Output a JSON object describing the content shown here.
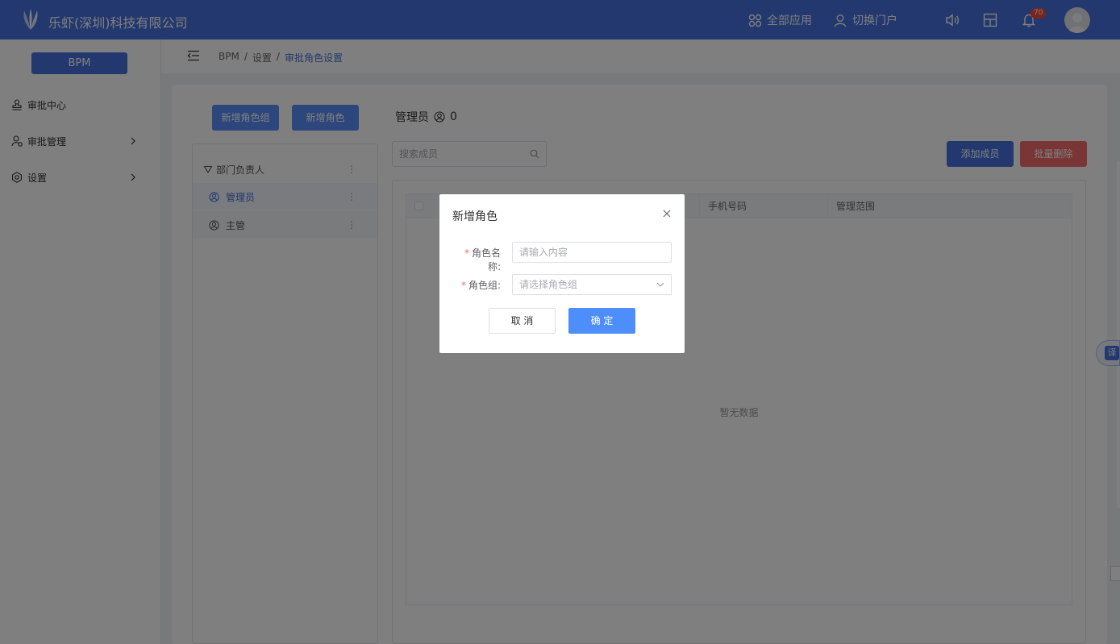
{
  "header": {
    "company": "乐虾(深圳)科技有限公司",
    "nav_all_apps": "全部应用",
    "nav_switch_portal": "切换门户",
    "notification_count": "70",
    "colors": {
      "primary": "#4671dc",
      "badge": "#f5483b"
    }
  },
  "sidebar": {
    "app_button": "BPM",
    "items": [
      {
        "label": "审批中心",
        "icon": "stamp-icon",
        "has_arrow": false
      },
      {
        "label": "审批管理",
        "icon": "approval-user-icon",
        "has_arrow": true
      },
      {
        "label": "设置",
        "icon": "gear-icon",
        "has_arrow": true
      }
    ]
  },
  "breadcrumb": [
    "BPM",
    "/",
    "设置",
    "/",
    "审批角色设置"
  ],
  "page": {
    "add_role_group_btn": "新增角色组",
    "add_role_btn": "新增角色",
    "role_title": "管理员",
    "role_member_count": "0",
    "search_placeholder": "搜索成员",
    "add_member_btn": "添加成员",
    "batch_delete_btn": "批量删除",
    "tree": {
      "group": "部门负责人",
      "roles": [
        "管理员",
        "主管"
      ]
    },
    "table": {
      "columns": [
        "手机号码",
        "管理范围"
      ],
      "empty_text": "暂无数据"
    }
  },
  "dialog": {
    "title": "新增角色",
    "role_name_label": "角色名称:",
    "role_name_placeholder": "请输入内容",
    "role_group_label": "角色组:",
    "role_group_placeholder": "请选择角色组",
    "cancel": "取 消",
    "confirm": "确 定"
  },
  "translate_label": "译"
}
